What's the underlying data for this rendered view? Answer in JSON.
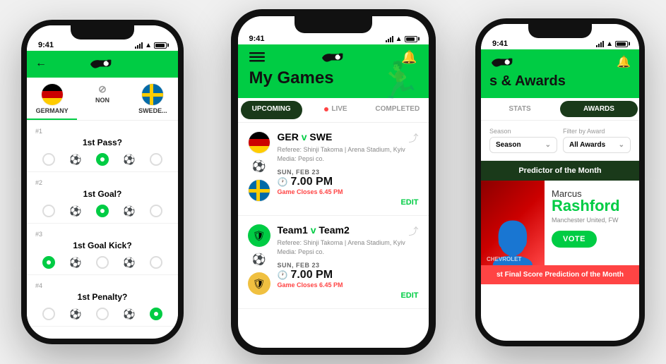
{
  "phones": {
    "left": {
      "status_time": "9:41",
      "back_label": "←",
      "tabs": [
        {
          "flag": "🇩🇪",
          "label": "GERMANY",
          "active": true
        },
        {
          "flag": "⊘",
          "label": "NON",
          "active": false
        },
        {
          "flag": "🇸🇪",
          "label": "SWEDE...",
          "active": false
        }
      ],
      "predictions": [
        {
          "number": "#1",
          "question": "1st Pass?",
          "left": false,
          "mid": true,
          "right": false
        },
        {
          "number": "#2",
          "question": "1st Goal?",
          "left": false,
          "mid": true,
          "right": false
        },
        {
          "number": "#3",
          "question": "1st Goal Kick?",
          "left": true,
          "mid": false,
          "right": false
        },
        {
          "number": "#4",
          "question": "1st Penalty?",
          "left": false,
          "mid": false,
          "right": true
        }
      ]
    },
    "center": {
      "status_time": "9:41",
      "page_title": "My Games",
      "tabs": [
        {
          "label": "UPCOMING",
          "active": true
        },
        {
          "label": "LIVE",
          "has_dot": true,
          "active": false
        },
        {
          "label": "COMPLETED",
          "active": false
        }
      ],
      "games": [
        {
          "team1": "GER",
          "versus": "v",
          "team2": "SWE",
          "referee": "Referee: Shinji Takoma | Arena Stadium, Kyiv",
          "media": "Media: Pepsi co.",
          "date": "SUN, FEB 23",
          "time": "7.00 PM",
          "closes": "Game Closes 6.45 PM",
          "edit_label": "EDIT",
          "team1_type": "de_flag",
          "team2_type": "se_flag"
        },
        {
          "team1": "Team1",
          "versus": "v",
          "team2": "Team2",
          "referee": "Referee: Shinji Takoma | Arena Stadium, Kyiv",
          "media": "Media: Pepsi co.",
          "date": "SUN, FEB 23",
          "time": "7.00 PM",
          "closes": "Game Closes 6.45 PM",
          "edit_label": "EDIT",
          "team1_type": "shield_green",
          "team2_type": "shield_gold"
        }
      ]
    },
    "right": {
      "status_time": "9:41",
      "page_title": "s & Awards",
      "tabs": [
        {
          "label": "STATS",
          "active": false
        },
        {
          "label": "AWARDS",
          "active": true
        }
      ],
      "filter_season_label": "Season",
      "filter_season_value": "Season",
      "filter_award_label": "Filter by Award",
      "filter_award_value": "All Awards",
      "predictor_banner": "Predictor of the Month",
      "player": {
        "first_name": "Marcus",
        "last_name": "Rashford",
        "club": "Manchester United, FW",
        "vote_label": "VOTE"
      },
      "final_score_banner": "st Final Score Prediction of the Month"
    }
  }
}
